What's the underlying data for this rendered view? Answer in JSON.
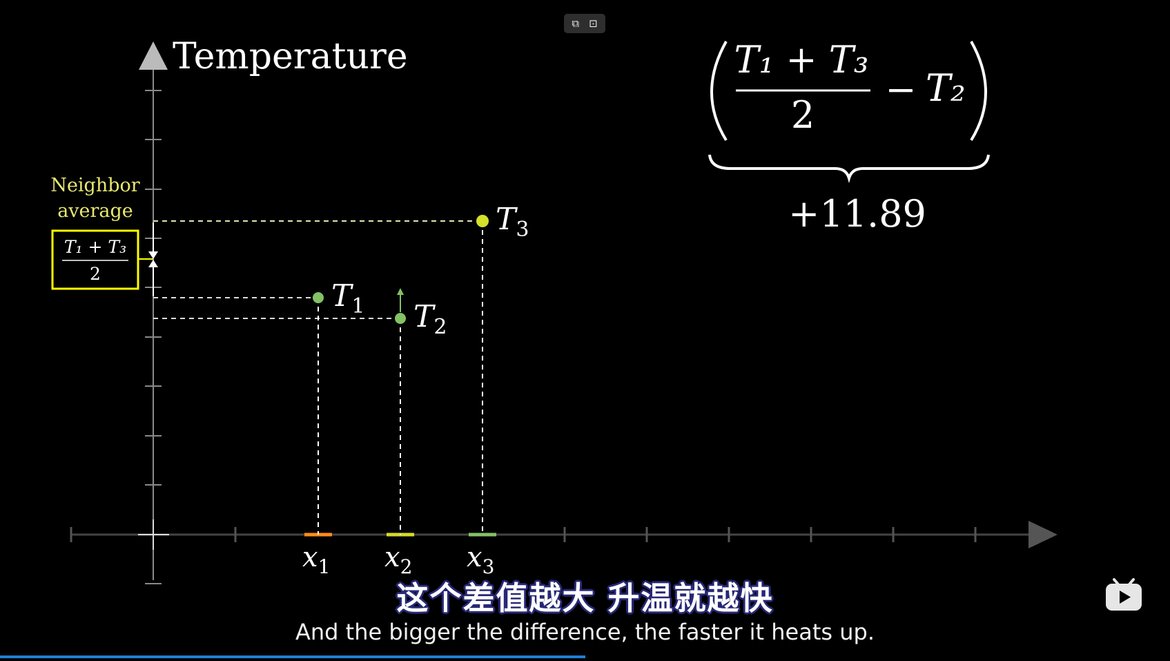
{
  "controls": {
    "pip_icon": "picture-in-picture-icon",
    "screenshot_icon": "screen-capture-icon",
    "pip_glyph": "⧉",
    "shot_glyph": "⊡"
  },
  "axis": {
    "y_label": "Temperature",
    "x_tick_labels": [
      {
        "base": "x",
        "sub": "1"
      },
      {
        "base": "x",
        "sub": "2"
      },
      {
        "base": "x",
        "sub": "3"
      }
    ]
  },
  "points": [
    {
      "base": "T",
      "sub": "1",
      "color": "#83c167"
    },
    {
      "base": "T",
      "sub": "2",
      "color": "#83c167"
    },
    {
      "base": "T",
      "sub": "3",
      "color": "#d4e02a"
    }
  ],
  "neighbor_box": {
    "caption_line1": "Neighbor",
    "caption_line2": "average",
    "numerator": "T₁ + T₃",
    "denominator": "2",
    "color": "#ffff00"
  },
  "formula": {
    "numerator": "T₁ + T₃",
    "denominator": "2",
    "minus": "−",
    "subtrahend": "T₂",
    "value": "+11.89"
  },
  "subtitles": {
    "zh": "这个差值越大  升温就越快",
    "en": "And the bigger the difference, the faster it heats up."
  },
  "colors": {
    "x1_segment": "#ff8c1a",
    "x2_segment": "#d8d82a",
    "x3_segment": "#83c167",
    "progress": "#1f7fd6"
  },
  "progress": {
    "fraction": 0.5
  }
}
